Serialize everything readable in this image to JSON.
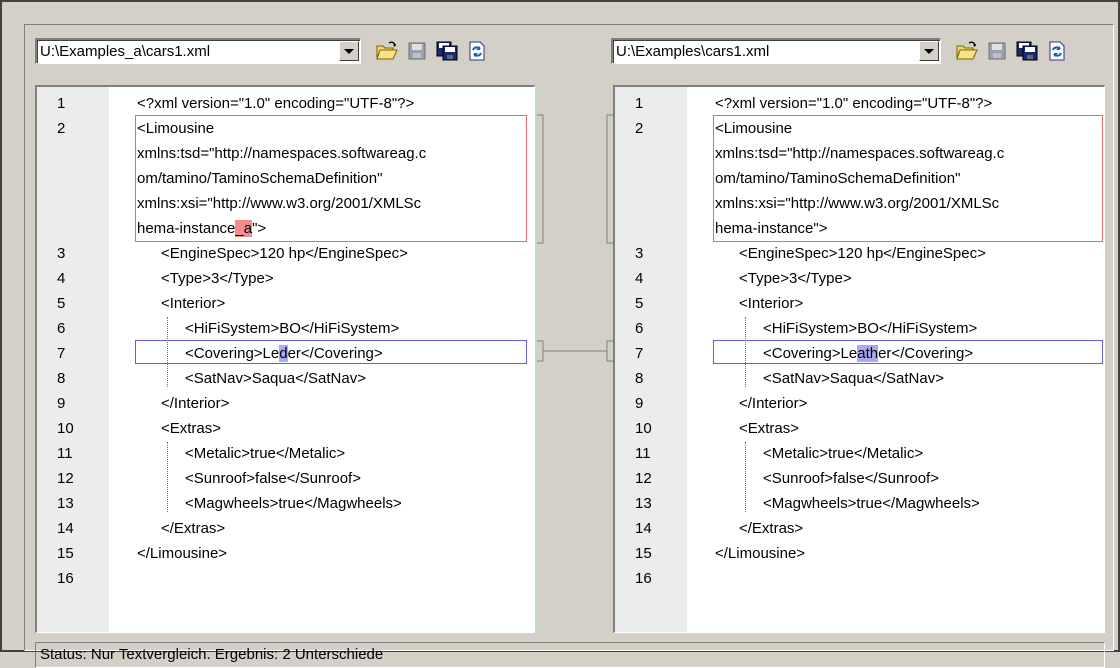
{
  "left": {
    "file_path": "U:\\Examples_a\\cars1.xml",
    "toolbar": {
      "icons": [
        "open-folder-icon",
        "save-icon",
        "save-as-icon",
        "refresh-icon"
      ]
    },
    "lines": [
      {
        "num": "1",
        "indent": 0,
        "text": "<?xml version=\"1.0\" encoding=\"UTF-8\"?>"
      },
      {
        "num": "2",
        "indent": 0,
        "text": "<Limousine"
      },
      {
        "num": "",
        "indent": 0,
        "text": "xmlns:tsd=\"http://namespaces.softwareag.c"
      },
      {
        "num": "",
        "indent": 0,
        "text": "om/tamino/TaminoSchemaDefinition\""
      },
      {
        "num": "",
        "indent": 0,
        "text": "xmlns:xsi=\"http://www.w3.org/2001/XMLSc"
      },
      {
        "num": "",
        "indent": 0,
        "pre": "hema-instance",
        "hl": "_a",
        "post": "\">"
      },
      {
        "num": "3",
        "indent": 1,
        "text": "<EngineSpec>120 hp</EngineSpec>"
      },
      {
        "num": "4",
        "indent": 1,
        "text": "<Type>3</Type>"
      },
      {
        "num": "5",
        "indent": 1,
        "text": "<Interior>"
      },
      {
        "num": "6",
        "indent": 2,
        "text": "<HiFiSystem>BO</HiFiSystem>"
      },
      {
        "num": "7",
        "indent": 2,
        "pre": "<Covering>Le",
        "hl": "d",
        "post": "er</Covering>"
      },
      {
        "num": "8",
        "indent": 2,
        "text": "<SatNav>Saqua</SatNav>"
      },
      {
        "num": "9",
        "indent": 1,
        "text": "</Interior>"
      },
      {
        "num": "10",
        "indent": 1,
        "text": "<Extras>"
      },
      {
        "num": "11",
        "indent": 2,
        "text": "<Metalic>true</Metalic>"
      },
      {
        "num": "12",
        "indent": 2,
        "text": "<Sunroof>false</Sunroof>"
      },
      {
        "num": "13",
        "indent": 2,
        "text": "<Magwheels>true</Magwheels>"
      },
      {
        "num": "14",
        "indent": 1,
        "text": "</Extras>"
      },
      {
        "num": "15",
        "indent": 0,
        "text": "</Limousine>"
      },
      {
        "num": "16",
        "indent": 0,
        "text": ""
      }
    ]
  },
  "right": {
    "file_path": "U:\\Examples\\cars1.xml",
    "toolbar": {
      "icons": [
        "open-folder-icon",
        "save-icon",
        "save-as-icon",
        "refresh-icon"
      ]
    },
    "lines": [
      {
        "num": "1",
        "indent": 0,
        "text": "<?xml version=\"1.0\" encoding=\"UTF-8\"?>"
      },
      {
        "num": "2",
        "indent": 0,
        "text": "<Limousine"
      },
      {
        "num": "",
        "indent": 0,
        "text": "xmlns:tsd=\"http://namespaces.softwareag.c"
      },
      {
        "num": "",
        "indent": 0,
        "text": "om/tamino/TaminoSchemaDefinition\""
      },
      {
        "num": "",
        "indent": 0,
        "text": "xmlns:xsi=\"http://www.w3.org/2001/XMLSc"
      },
      {
        "num": "",
        "indent": 0,
        "pre": "hema-instance",
        "hl": "",
        "post": "\">"
      },
      {
        "num": "3",
        "indent": 1,
        "text": "<EngineSpec>120 hp</EngineSpec>"
      },
      {
        "num": "4",
        "indent": 1,
        "text": "<Type>3</Type>"
      },
      {
        "num": "5",
        "indent": 1,
        "text": "<Interior>"
      },
      {
        "num": "6",
        "indent": 2,
        "text": "<HiFiSystem>BO</HiFiSystem>"
      },
      {
        "num": "7",
        "indent": 2,
        "pre": "<Covering>Le",
        "hl": "ath",
        "post": "er</Covering>"
      },
      {
        "num": "8",
        "indent": 2,
        "text": "<SatNav>Saqua</SatNav>"
      },
      {
        "num": "9",
        "indent": 1,
        "text": "</Interior>"
      },
      {
        "num": "10",
        "indent": 1,
        "text": "<Extras>"
      },
      {
        "num": "11",
        "indent": 2,
        "text": "<Metalic>true</Metalic>"
      },
      {
        "num": "12",
        "indent": 2,
        "text": "<Sunroof>false</Sunroof>"
      },
      {
        "num": "13",
        "indent": 2,
        "text": "<Magwheels>true</Magwheels>"
      },
      {
        "num": "14",
        "indent": 1,
        "text": "</Extras>"
      },
      {
        "num": "15",
        "indent": 0,
        "text": "</Limousine>"
      },
      {
        "num": "16",
        "indent": 0,
        "text": ""
      }
    ]
  },
  "status": "Status: Nur Textvergleich. Ergebnis: 2 Unterschiede",
  "colors": {
    "diff_text_border": "#e07070",
    "diff_text_highlight": "#f08c8c",
    "diff_active_border": "#6060d8",
    "diff_active_highlight": "#a8a8f4"
  }
}
